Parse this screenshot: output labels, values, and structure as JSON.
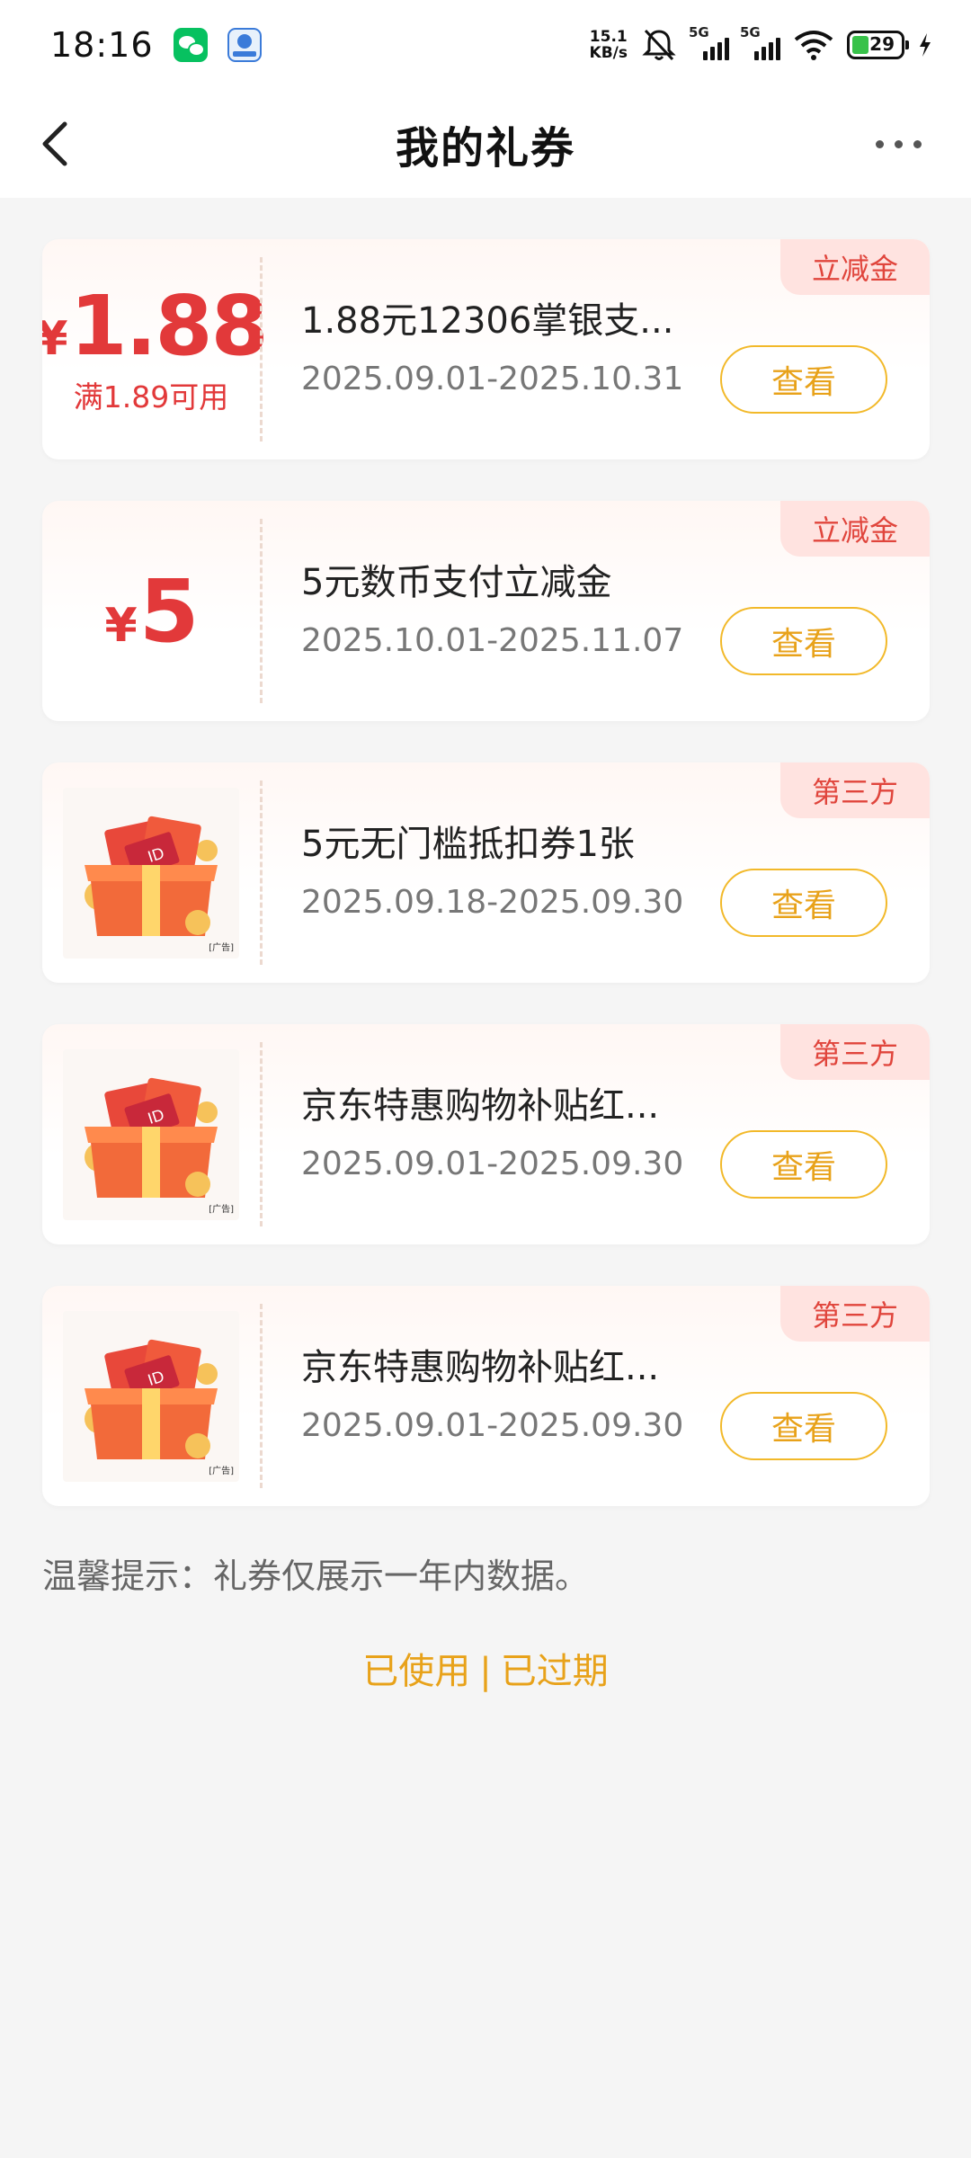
{
  "status_bar": {
    "time": "18:16",
    "net_speed_value": "15.1",
    "net_speed_unit": "KB/s",
    "signal1_label": "5G",
    "signal2_label": "5G",
    "battery": "29"
  },
  "header": {
    "title": "我的礼券"
  },
  "coupons": [
    {
      "currency": "¥",
      "amount": "1.88",
      "condition": "满1.89可用",
      "title": "1.88元12306掌银支...",
      "date": "2025.09.01-2025.10.31",
      "tag": "立减金",
      "button": "查看"
    },
    {
      "currency": "¥",
      "amount": "5",
      "condition": "",
      "title": "5元数币支付立减金",
      "date": "2025.10.01-2025.11.07",
      "tag": "立减金",
      "button": "查看"
    },
    {
      "image_ad_label": "[广告]",
      "title": "5元无门槛抵扣券1张",
      "date": "2025.09.18-2025.09.30",
      "tag": "第三方",
      "button": "查看"
    },
    {
      "image_ad_label": "[广告]",
      "title": "京东特惠购物补贴红...",
      "date": "2025.09.01-2025.09.30",
      "tag": "第三方",
      "button": "查看"
    },
    {
      "image_ad_label": "[广告]",
      "title": "京东特惠购物补贴红...",
      "date": "2025.09.01-2025.09.30",
      "tag": "第三方",
      "button": "查看"
    }
  ],
  "tip": "温馨提示：礼券仅展示一年内数据。",
  "links": {
    "used": "已使用",
    "separator": "|",
    "expired": "已过期"
  },
  "colors": {
    "accent_red": "#e2393a",
    "accent_orange": "#e8a21a",
    "tag_bg": "#ffe3e0"
  }
}
